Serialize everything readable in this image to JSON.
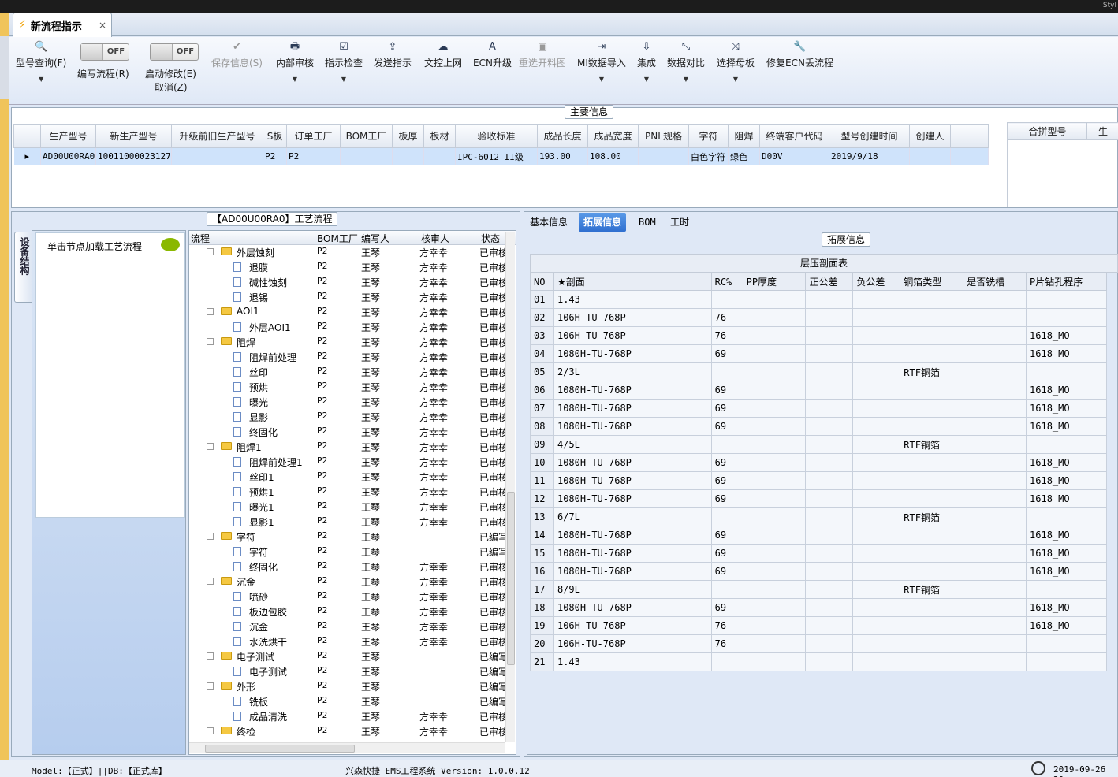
{
  "window": {
    "corner_text": "Styl"
  },
  "tab": {
    "title": "新流程指示",
    "close": "×"
  },
  "ribbon": {
    "search": "型号查询(F)",
    "toggle1": "OFF",
    "write": "编写流程(R)",
    "toggle2": "OFF",
    "start_edit": "启动修改(E)",
    "cancel": "取消(Z)",
    "save": "保存信息(S)",
    "review": "内部审核",
    "check": "指示检查",
    "send": "发送指示",
    "upload": "文控上网",
    "ecn": "ECN升级",
    "reselect": "重选开料图",
    "mi_import": "MI数据导入",
    "integrate": "集成",
    "compare": "数据对比",
    "mother": "选择母板",
    "repair": "修复ECN丢流程"
  },
  "main_info": {
    "title": "主要信息",
    "headers": [
      "生产型号",
      "新生产型号",
      "升级前旧生产型号",
      "S板",
      "订单工厂",
      "BOM工厂",
      "板厚",
      "板材",
      "验收标准",
      "成品长度",
      "成品宽度",
      "PNL规格",
      "字符",
      "阻焊",
      "终端客户代码",
      "型号创建时间",
      "创建人"
    ],
    "row": [
      "AD00U00RA0",
      "10011000023127",
      "",
      "P2",
      "P2",
      "",
      "",
      "",
      "IPC-6012 II级",
      "193.00",
      "108.00",
      "",
      "白色字符",
      "绿色",
      "D00V",
      "2019/9/18",
      ""
    ],
    "side_headers": [
      "合拼型号",
      "生"
    ]
  },
  "process": {
    "title": "【AD00U00RA0】工艺流程",
    "vtab": "设备结构",
    "hint": "单击节点加载工艺流程",
    "headers": [
      "流程",
      "BOM工厂",
      "编写人",
      "核审人",
      "状态"
    ],
    "rows": [
      {
        "n": "外层蚀刻",
        "g": 1,
        "f": "P2",
        "w": "王琴",
        "r": "方幸幸",
        "s": "已审核"
      },
      {
        "n": "退膜",
        "g": 0,
        "f": "P2",
        "w": "王琴",
        "r": "方幸幸",
        "s": "已审核"
      },
      {
        "n": "碱性蚀刻",
        "g": 0,
        "f": "P2",
        "w": "王琴",
        "r": "方幸幸",
        "s": "已审核"
      },
      {
        "n": "退锡",
        "g": 0,
        "f": "P2",
        "w": "王琴",
        "r": "方幸幸",
        "s": "已审核"
      },
      {
        "n": "AOI1",
        "g": 1,
        "f": "P2",
        "w": "王琴",
        "r": "方幸幸",
        "s": "已审核"
      },
      {
        "n": "外层AOI1",
        "g": 0,
        "f": "P2",
        "w": "王琴",
        "r": "方幸幸",
        "s": "已审核"
      },
      {
        "n": "阻焊",
        "g": 1,
        "f": "P2",
        "w": "王琴",
        "r": "方幸幸",
        "s": "已审核"
      },
      {
        "n": "阻焊前处理",
        "g": 0,
        "f": "P2",
        "w": "王琴",
        "r": "方幸幸",
        "s": "已审核"
      },
      {
        "n": "丝印",
        "g": 0,
        "f": "P2",
        "w": "王琴",
        "r": "方幸幸",
        "s": "已审核"
      },
      {
        "n": "预烘",
        "g": 0,
        "f": "P2",
        "w": "王琴",
        "r": "方幸幸",
        "s": "已审核"
      },
      {
        "n": "曝光",
        "g": 0,
        "f": "P2",
        "w": "王琴",
        "r": "方幸幸",
        "s": "已审核"
      },
      {
        "n": "显影",
        "g": 0,
        "f": "P2",
        "w": "王琴",
        "r": "方幸幸",
        "s": "已审核"
      },
      {
        "n": "终固化",
        "g": 0,
        "f": "P2",
        "w": "王琴",
        "r": "方幸幸",
        "s": "已审核"
      },
      {
        "n": "阻焊1",
        "g": 1,
        "f": "P2",
        "w": "王琴",
        "r": "方幸幸",
        "s": "已审核"
      },
      {
        "n": "阻焊前处理1",
        "g": 0,
        "f": "P2",
        "w": "王琴",
        "r": "方幸幸",
        "s": "已审核"
      },
      {
        "n": "丝印1",
        "g": 0,
        "f": "P2",
        "w": "王琴",
        "r": "方幸幸",
        "s": "已审核"
      },
      {
        "n": "预烘1",
        "g": 0,
        "f": "P2",
        "w": "王琴",
        "r": "方幸幸",
        "s": "已审核"
      },
      {
        "n": "曝光1",
        "g": 0,
        "f": "P2",
        "w": "王琴",
        "r": "方幸幸",
        "s": "已审核"
      },
      {
        "n": "显影1",
        "g": 0,
        "f": "P2",
        "w": "王琴",
        "r": "方幸幸",
        "s": "已审核"
      },
      {
        "n": "字符",
        "g": 1,
        "f": "P2",
        "w": "王琴",
        "r": "",
        "s": "已编写"
      },
      {
        "n": "字符",
        "g": 0,
        "f": "P2",
        "w": "王琴",
        "r": "",
        "s": "已编写"
      },
      {
        "n": "终固化",
        "g": 0,
        "f": "P2",
        "w": "王琴",
        "r": "方幸幸",
        "s": "已审核"
      },
      {
        "n": "沉金",
        "g": 1,
        "f": "P2",
        "w": "王琴",
        "r": "方幸幸",
        "s": "已审核"
      },
      {
        "n": "喷砂",
        "g": 0,
        "f": "P2",
        "w": "王琴",
        "r": "方幸幸",
        "s": "已审核"
      },
      {
        "n": "板边包胶",
        "g": 0,
        "f": "P2",
        "w": "王琴",
        "r": "方幸幸",
        "s": "已审核"
      },
      {
        "n": "沉金",
        "g": 0,
        "f": "P2",
        "w": "王琴",
        "r": "方幸幸",
        "s": "已审核"
      },
      {
        "n": "水洗烘干",
        "g": 0,
        "f": "P2",
        "w": "王琴",
        "r": "方幸幸",
        "s": "已审核"
      },
      {
        "n": "电子测试",
        "g": 1,
        "f": "P2",
        "w": "王琴",
        "r": "",
        "s": "已编写"
      },
      {
        "n": "电子测试",
        "g": 0,
        "f": "P2",
        "w": "王琴",
        "r": "",
        "s": "已编写"
      },
      {
        "n": "外形",
        "g": 1,
        "f": "P2",
        "w": "王琴",
        "r": "",
        "s": "已编写"
      },
      {
        "n": "铣板",
        "g": 0,
        "f": "P2",
        "w": "王琴",
        "r": "",
        "s": "已编写"
      },
      {
        "n": "成品清洗",
        "g": 0,
        "f": "P2",
        "w": "王琴",
        "r": "方幸幸",
        "s": "已审核"
      },
      {
        "n": "终检",
        "g": 1,
        "f": "P2",
        "w": "王琴",
        "r": "方幸幸",
        "s": "已审核"
      }
    ]
  },
  "detail": {
    "tabs": [
      "基本信息",
      "拓展信息",
      "BOM",
      "工时"
    ],
    "active_tab": 1,
    "section": "拓展信息",
    "table_title": "层压剖面表",
    "headers": [
      "NO",
      "★剖面",
      "RC%",
      "PP厚度",
      "正公差",
      "负公差",
      "铜箔类型",
      "是否铣槽",
      "P片钻孔程序"
    ],
    "rows": [
      [
        "01",
        "1.43",
        "",
        "",
        "",
        "",
        "",
        "",
        ""
      ],
      [
        "02",
        "106H-TU-768P",
        "76",
        "",
        "",
        "",
        "",
        "",
        ""
      ],
      [
        "03",
        "106H-TU-768P",
        "76",
        "",
        "",
        "",
        "",
        "",
        "1618_MO"
      ],
      [
        "04",
        "1080H-TU-768P",
        "69",
        "",
        "",
        "",
        "",
        "",
        "1618_MO"
      ],
      [
        "05",
        "2/3L",
        "",
        "",
        "",
        "",
        "RTF铜箔",
        "",
        ""
      ],
      [
        "06",
        "1080H-TU-768P",
        "69",
        "",
        "",
        "",
        "",
        "",
        "1618_MO"
      ],
      [
        "07",
        "1080H-TU-768P",
        "69",
        "",
        "",
        "",
        "",
        "",
        "1618_MO"
      ],
      [
        "08",
        "1080H-TU-768P",
        "69",
        "",
        "",
        "",
        "",
        "",
        "1618_MO"
      ],
      [
        "09",
        "4/5L",
        "",
        "",
        "",
        "",
        "RTF铜箔",
        "",
        ""
      ],
      [
        "10",
        "1080H-TU-768P",
        "69",
        "",
        "",
        "",
        "",
        "",
        "1618_MO"
      ],
      [
        "11",
        "1080H-TU-768P",
        "69",
        "",
        "",
        "",
        "",
        "",
        "1618_MO"
      ],
      [
        "12",
        "1080H-TU-768P",
        "69",
        "",
        "",
        "",
        "",
        "",
        "1618_MO"
      ],
      [
        "13",
        "6/7L",
        "",
        "",
        "",
        "",
        "RTF铜箔",
        "",
        ""
      ],
      [
        "14",
        "1080H-TU-768P",
        "69",
        "",
        "",
        "",
        "",
        "",
        "1618_MO"
      ],
      [
        "15",
        "1080H-TU-768P",
        "69",
        "",
        "",
        "",
        "",
        "",
        "1618_MO"
      ],
      [
        "16",
        "1080H-TU-768P",
        "69",
        "",
        "",
        "",
        "",
        "",
        "1618_MO"
      ],
      [
        "17",
        "8/9L",
        "",
        "",
        "",
        "",
        "RTF铜箔",
        "",
        ""
      ],
      [
        "18",
        "1080H-TU-768P",
        "69",
        "",
        "",
        "",
        "",
        "",
        "1618_MO"
      ],
      [
        "19",
        "106H-TU-768P",
        "76",
        "",
        "",
        "",
        "",
        "",
        "1618_MO"
      ],
      [
        "20",
        "106H-TU-768P",
        "76",
        "",
        "",
        "",
        "",
        "",
        ""
      ],
      [
        "21",
        "1.43",
        "",
        "",
        "",
        "",
        "",
        "",
        ""
      ]
    ]
  },
  "status": {
    "left": "Model:【正式】||DB:【正式库】",
    "center": "兴森快捷 EMS工程系统 Version: 1.0.0.12",
    "right": "2019-09-26 20"
  }
}
